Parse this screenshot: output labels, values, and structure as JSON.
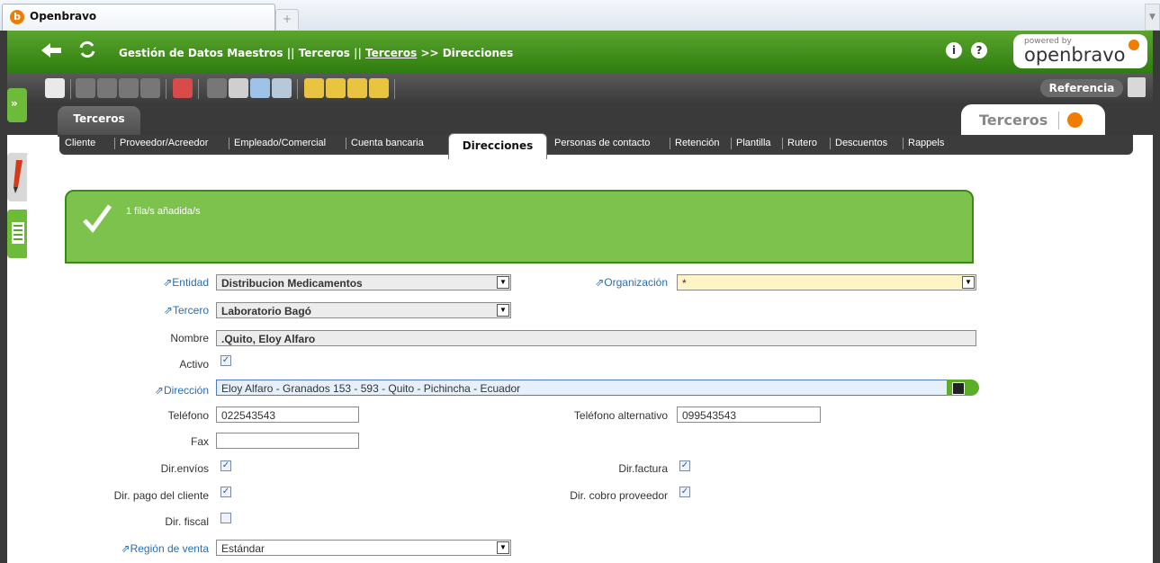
{
  "browser": {
    "tab_title": "Openbravo",
    "new_tab": "+"
  },
  "header": {
    "breadcrumb_1": "Gestión de Datos Maestros || Terceros ||",
    "breadcrumb_link": "Terceros",
    "breadcrumb_2": ">> Direcciones",
    "info": "i",
    "help": "?",
    "logo_powered": "powered by",
    "logo_name": "openbravo"
  },
  "toolbar": {
    "referencia": "Referencia"
  },
  "window": {
    "tab": "Terceros",
    "title": "Terceros"
  },
  "subtabs": [
    "Cliente",
    "Proveedor/Acreedor",
    "Empleado/Comercial",
    "Cuenta bancaria",
    "Personas de contacto",
    "Retención",
    "Plantilla",
    "Rutero",
    "Descuentos",
    "Rappels"
  ],
  "active_subtab": "Direcciones",
  "message": "1 fila/s añadida/s",
  "form": {
    "entidad_label": "Entidad",
    "entidad_value": "Distribucion Medicamentos",
    "organizacion_label": "Organización",
    "organizacion_value": "*",
    "tercero_label": "Tercero",
    "tercero_value": "Laboratorio Bagó",
    "nombre_label": "Nombre",
    "nombre_value": ".Quito, Eloy Alfaro",
    "activo_label": "Activo",
    "direccion_label": "Dirección",
    "direccion_value": "Eloy Alfaro  - Granados 153 - 593 - Quito -  Pichincha - Ecuador",
    "telefono_label": "Teléfono",
    "telefono_value": "022543543",
    "telefono_alt_label": "Teléfono alternativo",
    "telefono_alt_value": "099543543",
    "fax_label": "Fax",
    "fax_value": "",
    "dir_envios_label": "Dir.envíos",
    "dir_factura_label": "Dir.factura",
    "dir_pago_label": "Dir. pago del cliente",
    "dir_cobro_label": "Dir. cobro proveedor",
    "dir_fiscal_label": "Dir. fiscal",
    "region_label": "Región de venta",
    "region_value": "Estándar"
  },
  "checkboxes": {
    "activo": true,
    "dir_envios": true,
    "dir_factura": true,
    "dir_pago": true,
    "dir_cobro": true,
    "dir_fiscal": false
  },
  "colors": {
    "header_green": "#3f8f1c",
    "required_label": "#2a6db0",
    "message_green": "#7cc24d"
  }
}
